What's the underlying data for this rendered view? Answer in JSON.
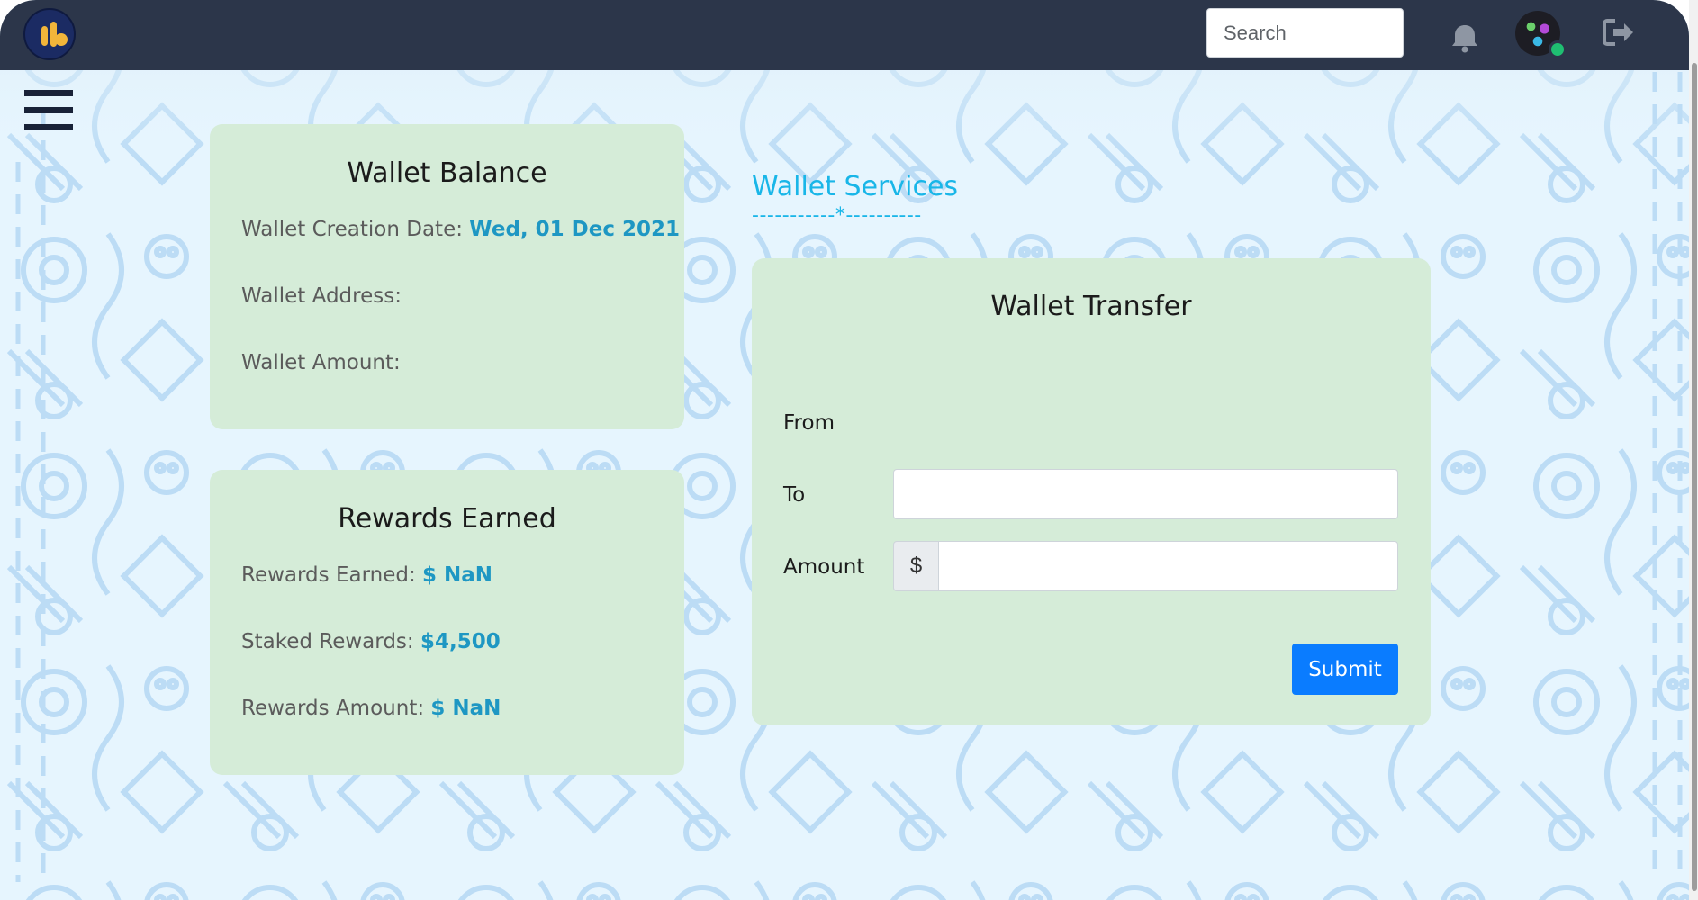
{
  "header": {
    "search": {
      "placeholder": "Search"
    }
  },
  "wallet_balance": {
    "title": "Wallet Balance",
    "creation_date_label": "Wallet Creation Date:",
    "creation_date_value": "Wed, 01 Dec 2021",
    "address_label": "Wallet Address:",
    "amount_label": "Wallet Amount:"
  },
  "rewards": {
    "title": "Rewards Earned",
    "earned_label": "Rewards Earned:",
    "earned_value": "$ NaN",
    "staked_label": "Staked Rewards:",
    "staked_value": "$4,500",
    "amount_label": "Rewards Amount:",
    "amount_value": "$ NaN"
  },
  "services": {
    "title": "Wallet Services",
    "divider": "-----------*----------"
  },
  "transfer": {
    "title": "Wallet Transfer",
    "from_label": "From",
    "to_label": "To",
    "amount_label": "Amount",
    "currency_prefix": "$",
    "submit_label": "Submit"
  },
  "colors": {
    "topbar": "#2c364a",
    "card": "#d5ecd8",
    "accent": "#1e97c3",
    "services": "#19b6e8",
    "button": "#0a7cff"
  }
}
